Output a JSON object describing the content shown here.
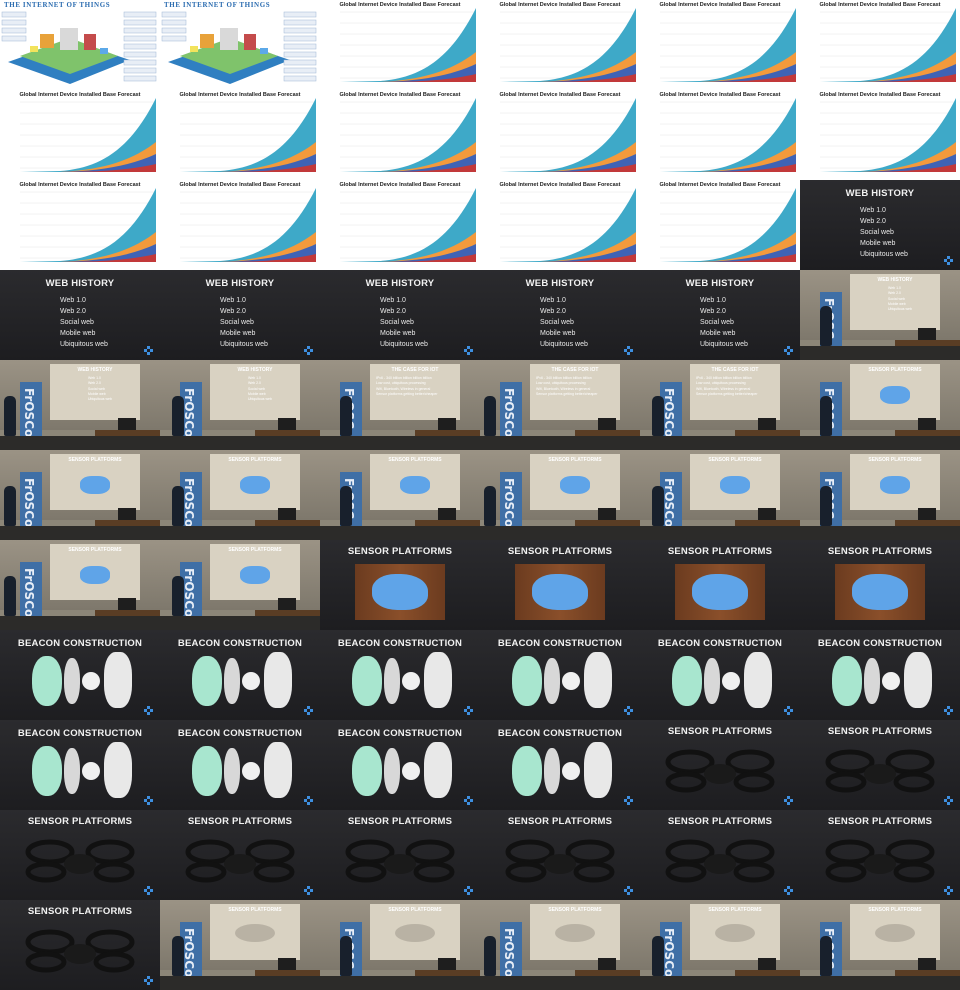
{
  "slides": {
    "web_history": {
      "title": "WEB HISTORY",
      "items": [
        "Web 1.0",
        "Web 2.0",
        "Social web",
        "Mobile web",
        "Ubiquitous web"
      ]
    },
    "case_for_iot": {
      "title": "THE CASE FOR IOT",
      "items": [
        "IPv6 - 340 billion billion billion billion",
        "Low cost, ubiquitous processing",
        "Wifi, Bluetooth, Wireless in general",
        "Sensor platforms getting better/cheaper"
      ]
    },
    "sensor_platforms": {
      "title": "SENSOR PLATFORMS"
    },
    "beacon_construction": {
      "title": "BEACON CONSTRUCTION"
    },
    "iot_poster": {
      "title": "THE INTERNET OF THINGS"
    },
    "chart": {
      "title": "Global Internet Device Installed Base Forecast"
    },
    "venue_banner": {
      "text": "FrOSCon"
    }
  },
  "colors": {
    "slide_bg": "#232326",
    "nav_icon": "#3d8fe0",
    "chart_teal": "#3ea9c8",
    "chart_orange": "#f39a3c",
    "chart_blue": "#3f63b5",
    "chart_red": "#c2393a",
    "beacon_mint": "#a8e6cf",
    "beacon_blue": "#5fa4e8"
  }
}
